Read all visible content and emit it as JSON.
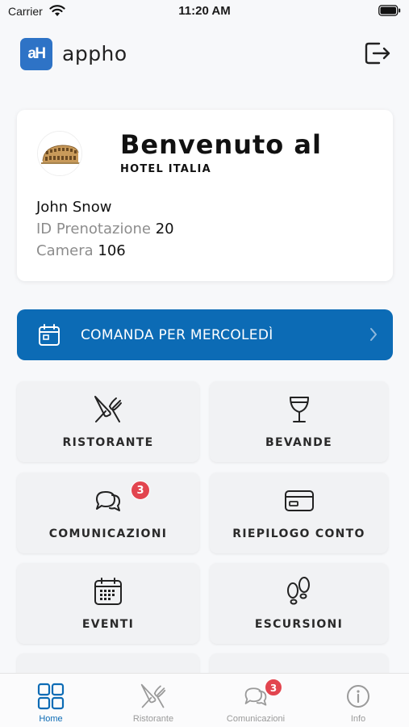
{
  "status_bar": {
    "carrier": "Carrier",
    "time": "11:20 AM"
  },
  "header": {
    "logo_text": "aH",
    "app_name": "appho"
  },
  "welcome": {
    "title": "Benvenuto al",
    "hotel_name": "HOTEL ITALIA",
    "guest_name": "John Snow",
    "booking_label": "ID Prenotazione",
    "booking_id": "20",
    "room_label": "Camera",
    "room_number": "106"
  },
  "order_button": {
    "label": "COMANDA PER MERCOLEDÌ"
  },
  "tiles": [
    {
      "label": "RISTORANTE",
      "icon": "cutlery-icon"
    },
    {
      "label": "BEVANDE",
      "icon": "wine-glass-icon"
    },
    {
      "label": "COMUNICAZIONI",
      "icon": "chat-icon",
      "badge": "3"
    },
    {
      "label": "RIEPILOGO CONTO",
      "icon": "credit-card-icon"
    },
    {
      "label": "EVENTI",
      "icon": "calendar-icon"
    },
    {
      "label": "ESCURSIONI",
      "icon": "footprints-icon"
    }
  ],
  "tab_bar": [
    {
      "label": "Home",
      "icon": "grid-icon",
      "active": true
    },
    {
      "label": "Ristorante",
      "icon": "cutlery-icon"
    },
    {
      "label": "Comunicazioni",
      "icon": "chat-icon",
      "badge": "3"
    },
    {
      "label": "Info",
      "icon": "info-icon"
    }
  ],
  "colors": {
    "primary": "#0c6bb5",
    "logo": "#2e73c6",
    "badge": "#e2454f",
    "background": "#f7f8fa"
  }
}
